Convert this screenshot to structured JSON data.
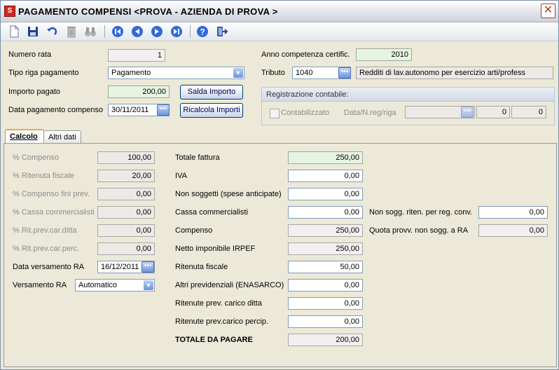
{
  "window": {
    "title": "PAGAMENTO COMPENSI <PROVA - AZIENDA DI PROVA >",
    "app_icon_letter": "S",
    "close_glyph": "✕"
  },
  "toolbar": {
    "icons": [
      "new-document-icon",
      "save-icon",
      "undo-icon",
      "delete-icon",
      "search-binoculars-icon",
      "first-record-icon",
      "previous-record-icon",
      "next-record-icon",
      "last-record-icon",
      "help-icon",
      "exit-icon"
    ]
  },
  "header": {
    "numero_rata_label": "Numero rata",
    "numero_rata_value": "1",
    "tipo_riga_label": "Tipo riga pagamento",
    "tipo_riga_value": "Pagamento",
    "importo_pagato_label": "Importo pagato",
    "importo_pagato_value": "200,00",
    "data_pagamento_label": "Data pagamento compenso",
    "data_pagamento_value": "30/11/2011",
    "saldo_button": "Salda Importo",
    "ricalcola_button": "Ricalcola Importi",
    "anno_label": "Anno competenza certific.",
    "anno_value": "2010",
    "tributo_label": "Tributo",
    "tributo_code": "1040",
    "tributo_desc": "Redditi di lav.autonomo per esercizio arti/profess"
  },
  "registrazione": {
    "title": "Registrazione contabile:",
    "contabilizzato_label": "Contabilizzato",
    "data_label": "Data/N.reg/riga",
    "data_value": "",
    "nreg_value": "0",
    "riga_value": "0"
  },
  "tabs": [
    {
      "label": "Calcolo"
    },
    {
      "label": "Altri dati"
    }
  ],
  "left_fields": [
    {
      "label": "% Compenso",
      "value": "100,00"
    },
    {
      "label": "% Ritenuta fiscale",
      "value": "20,00"
    },
    {
      "label": "% Compenso fini prev.",
      "value": "0,00"
    },
    {
      "label": "% Cassa commercialisti",
      "value": "0,00"
    },
    {
      "label": "% Rit.prev.car.ditta",
      "value": "0,00"
    },
    {
      "label": "% Rit.prev.car.perc.",
      "value": "0,00"
    }
  ],
  "versamento": {
    "data_label": "Data versamento RA",
    "data_value": "16/12/2011",
    "tipo_label": "Versamento RA",
    "tipo_value": "Automatico"
  },
  "middle_fields": [
    {
      "label": "Totale fattura",
      "value": "250,00"
    },
    {
      "label": "IVA",
      "value": "0,00"
    },
    {
      "label": "Non soggetti (spese anticipate)",
      "value": "0,00"
    },
    {
      "label": "Cassa commercialisti",
      "value": "0,00"
    },
    {
      "label": "Compenso",
      "value": "250,00"
    },
    {
      "label": "Netto imponibile IRPEF",
      "value": "250,00"
    },
    {
      "label": "Ritenuta fiscale",
      "value": "50,00"
    },
    {
      "label": "Altri previdenziali (ENASARCO)",
      "value": "0,00"
    },
    {
      "label": "Ritenute prev. carico ditta",
      "value": "0,00"
    },
    {
      "label": "Ritenute prev.carico percip.",
      "value": "0,00"
    },
    {
      "label": "TOTALE DA PAGARE",
      "value": "200,00"
    }
  ],
  "right_fields": [
    {
      "label": "Non sogg. riten. per reg. conv.",
      "value": "0,00"
    },
    {
      "label": "Quota provv. non sogg. a RA",
      "value": "0,00"
    }
  ]
}
